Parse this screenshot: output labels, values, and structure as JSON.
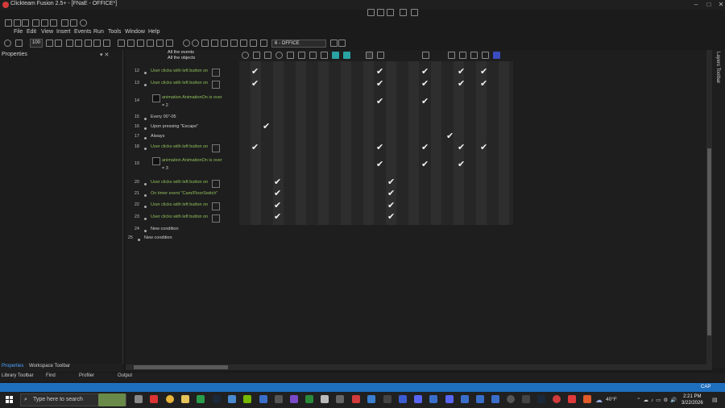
{
  "window": {
    "title": "Clickteam Fusion 2.5+ - [FNaE - OFFICE*]"
  },
  "menu": [
    "File",
    "Edit",
    "View",
    "Insert",
    "Events",
    "Run",
    "Tools",
    "Window",
    "Help"
  ],
  "toolbar": {
    "zoom": "100",
    "frame": "6 - OFFICE"
  },
  "properties": {
    "title": "Properties"
  },
  "editor_header": {
    "all_events": "All the events",
    "all_objects": "All the objects"
  },
  "events": [
    {
      "num": "12",
      "text": "User clicks with left button on",
      "green": true,
      "box": true
    },
    {
      "num": "13",
      "text": "User clicks with left button on",
      "green": true,
      "box": true
    },
    {
      "num": "14",
      "text": "animation AnimationOn is over",
      "green": true,
      "box": false,
      "sub": "= 2"
    },
    {
      "num": "15",
      "text": "Every 00\"-05",
      "green": false,
      "box": false
    },
    {
      "num": "16",
      "text": "Upon pressing \"Escape\"",
      "green": false,
      "box": false
    },
    {
      "num": "17",
      "text": "Always",
      "green": false,
      "box": false
    },
    {
      "num": "18",
      "text": "User clicks with left button on",
      "green": true,
      "box": true
    },
    {
      "num": "19",
      "text": "animation AnimationOn is over",
      "green": true,
      "box": false,
      "sub": "= 3"
    },
    {
      "num": "20",
      "text": "User clicks with left button on",
      "green": true,
      "box": true
    },
    {
      "num": "21",
      "text": "On timer event \"Cam/FloorSwitch\"",
      "green": true,
      "box": false
    },
    {
      "num": "22",
      "text": "User clicks with left button on",
      "green": true,
      "box": true
    },
    {
      "num": "23",
      "text": "User clicks with left button on",
      "green": true,
      "box": true
    },
    {
      "num": "24",
      "text": "New condition",
      "green": false,
      "box": false
    },
    {
      "num": "25",
      "text": "New condition",
      "green": false,
      "box": false
    }
  ],
  "layers_toolbar": {
    "label": "Layers Toolbar"
  },
  "bottom_tabs_top": [
    "Properties",
    "Workspace Toolbar"
  ],
  "bottom_tabs": [
    "Library Toolbar",
    "Find",
    "Profiler",
    "Output"
  ],
  "status": {
    "caps": "CAP"
  },
  "taskbar": {
    "search_placeholder": "Type here to search",
    "weather": "40°F",
    "time": "2:21 PM",
    "date": "3/22/2026"
  }
}
